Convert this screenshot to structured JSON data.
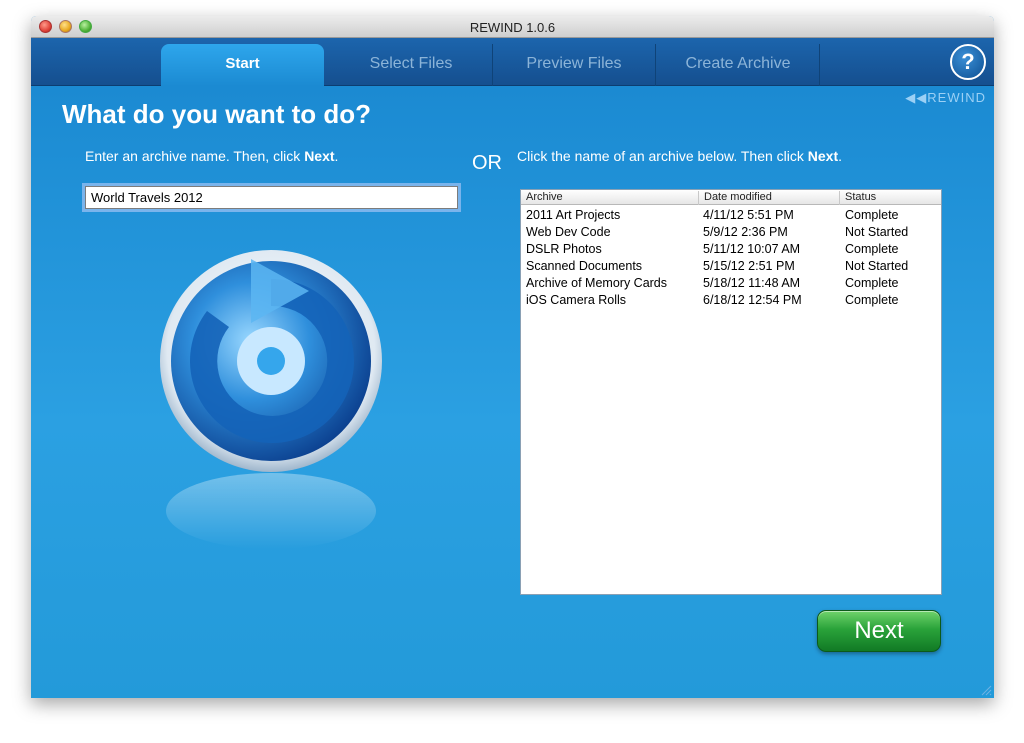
{
  "window": {
    "title": "REWIND 1.0.6"
  },
  "tabs": [
    {
      "label": "Start",
      "active": true
    },
    {
      "label": "Select Files",
      "active": false
    },
    {
      "label": "Preview Files",
      "active": false
    },
    {
      "label": "Create Archive",
      "active": false
    }
  ],
  "help": {
    "icon": "help-icon",
    "glyph": "?"
  },
  "brand": {
    "text": "◀◀REWIND"
  },
  "main": {
    "heading": "What do you want to do?",
    "left_instruction_prefix": "Enter an archive name. Then, click ",
    "left_instruction_bold": "Next",
    "left_instruction_suffix": ".",
    "or_label": "OR",
    "right_instruction_prefix": "Click the name of an archive below. Then click ",
    "right_instruction_bold": "Next",
    "right_instruction_suffix": ".",
    "archive_name_value": "World Travels 2012"
  },
  "archive_table": {
    "columns": [
      "Archive",
      "Date modified",
      "Status"
    ],
    "rows": [
      {
        "archive": "2011 Art Projects",
        "date": "4/11/12 5:51 PM",
        "status": "Complete"
      },
      {
        "archive": "Web Dev Code",
        "date": "5/9/12 2:36 PM",
        "status": "Not Started"
      },
      {
        "archive": "DSLR Photos",
        "date": "5/11/12 10:07 AM",
        "status": "Complete"
      },
      {
        "archive": "Scanned Documents",
        "date": "5/15/12 2:51 PM",
        "status": "Not Started"
      },
      {
        "archive": "Archive of Memory Cards",
        "date": "5/18/12 11:48 AM",
        "status": "Complete"
      },
      {
        "archive": "iOS Camera Rolls",
        "date": "6/18/12 12:54 PM",
        "status": "Complete"
      }
    ]
  },
  "next_button": {
    "label": "Next"
  },
  "colors": {
    "background": "#1b8ad2",
    "tabbar": "#154f8f",
    "next_button": "#2aa33a"
  }
}
